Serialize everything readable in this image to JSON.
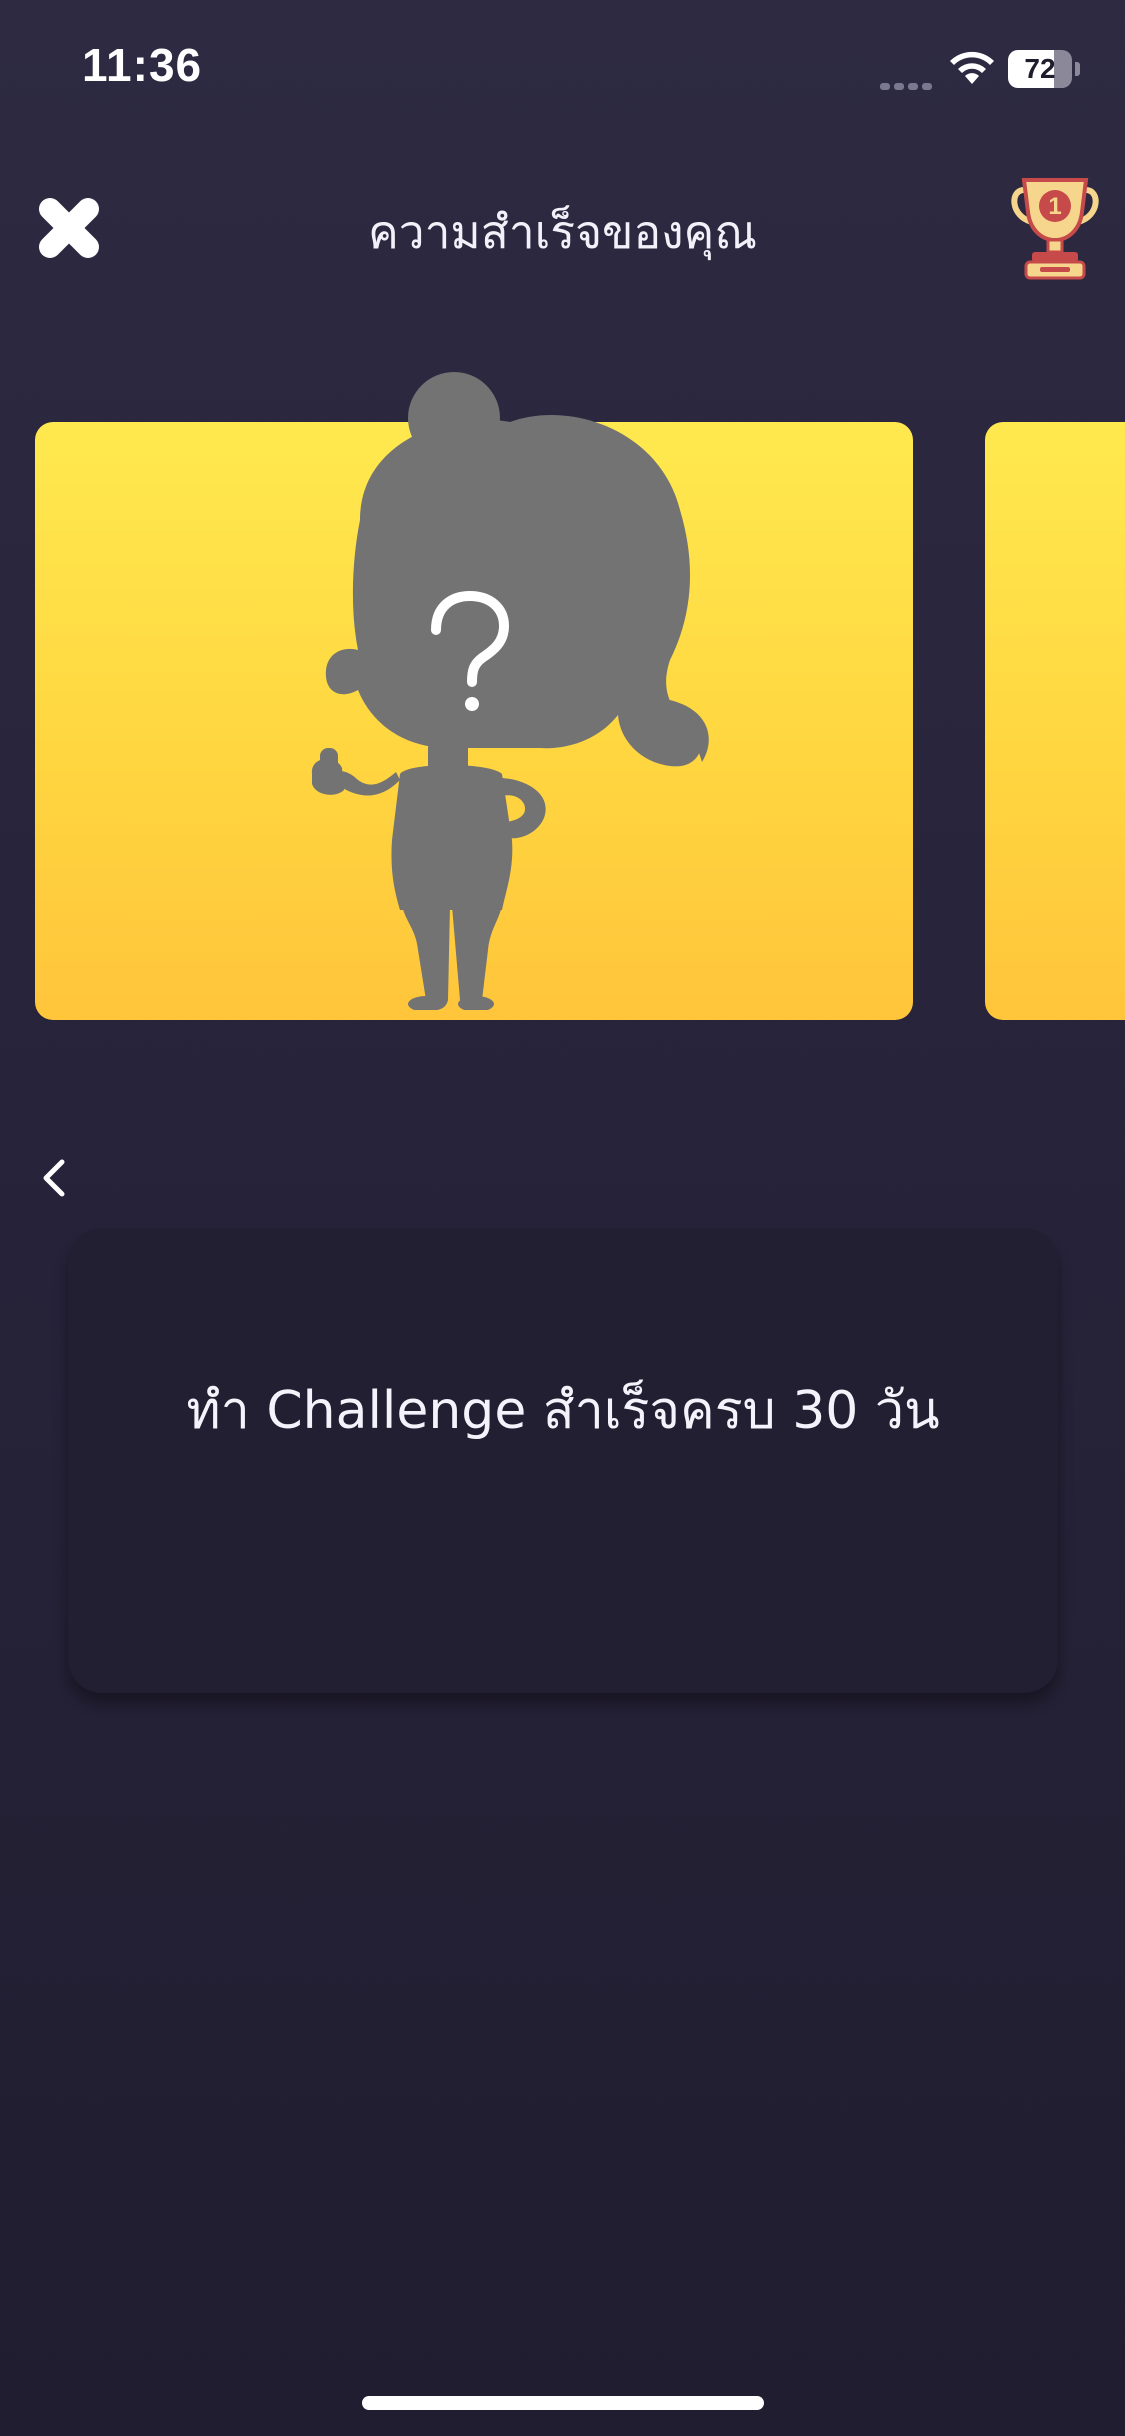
{
  "status_bar": {
    "time": "11:36",
    "battery_level": "72"
  },
  "header": {
    "title": "ความสำเร็จของคุณ",
    "close_icon": "close-x-icon",
    "trophy_icon": "trophy-icon",
    "trophy_rank": "1"
  },
  "carousel": {
    "cards": [
      {
        "state": "locked",
        "icon": "mystery-character-silhouette",
        "mark": "?"
      },
      {
        "state": "partially-visible"
      }
    ],
    "prev_icon": "chevron-left-icon"
  },
  "achievement": {
    "description": "ทำ Challenge สำเร็จครบ 30 วัน"
  },
  "colors": {
    "background": "#2b2840",
    "panel": "#231f33",
    "card_yellow_top": "#ffe94f",
    "card_yellow_bottom": "#ffc53b",
    "silhouette": "#737373",
    "trophy_gold": "#f6d68d",
    "trophy_red": "#c64a4a"
  }
}
